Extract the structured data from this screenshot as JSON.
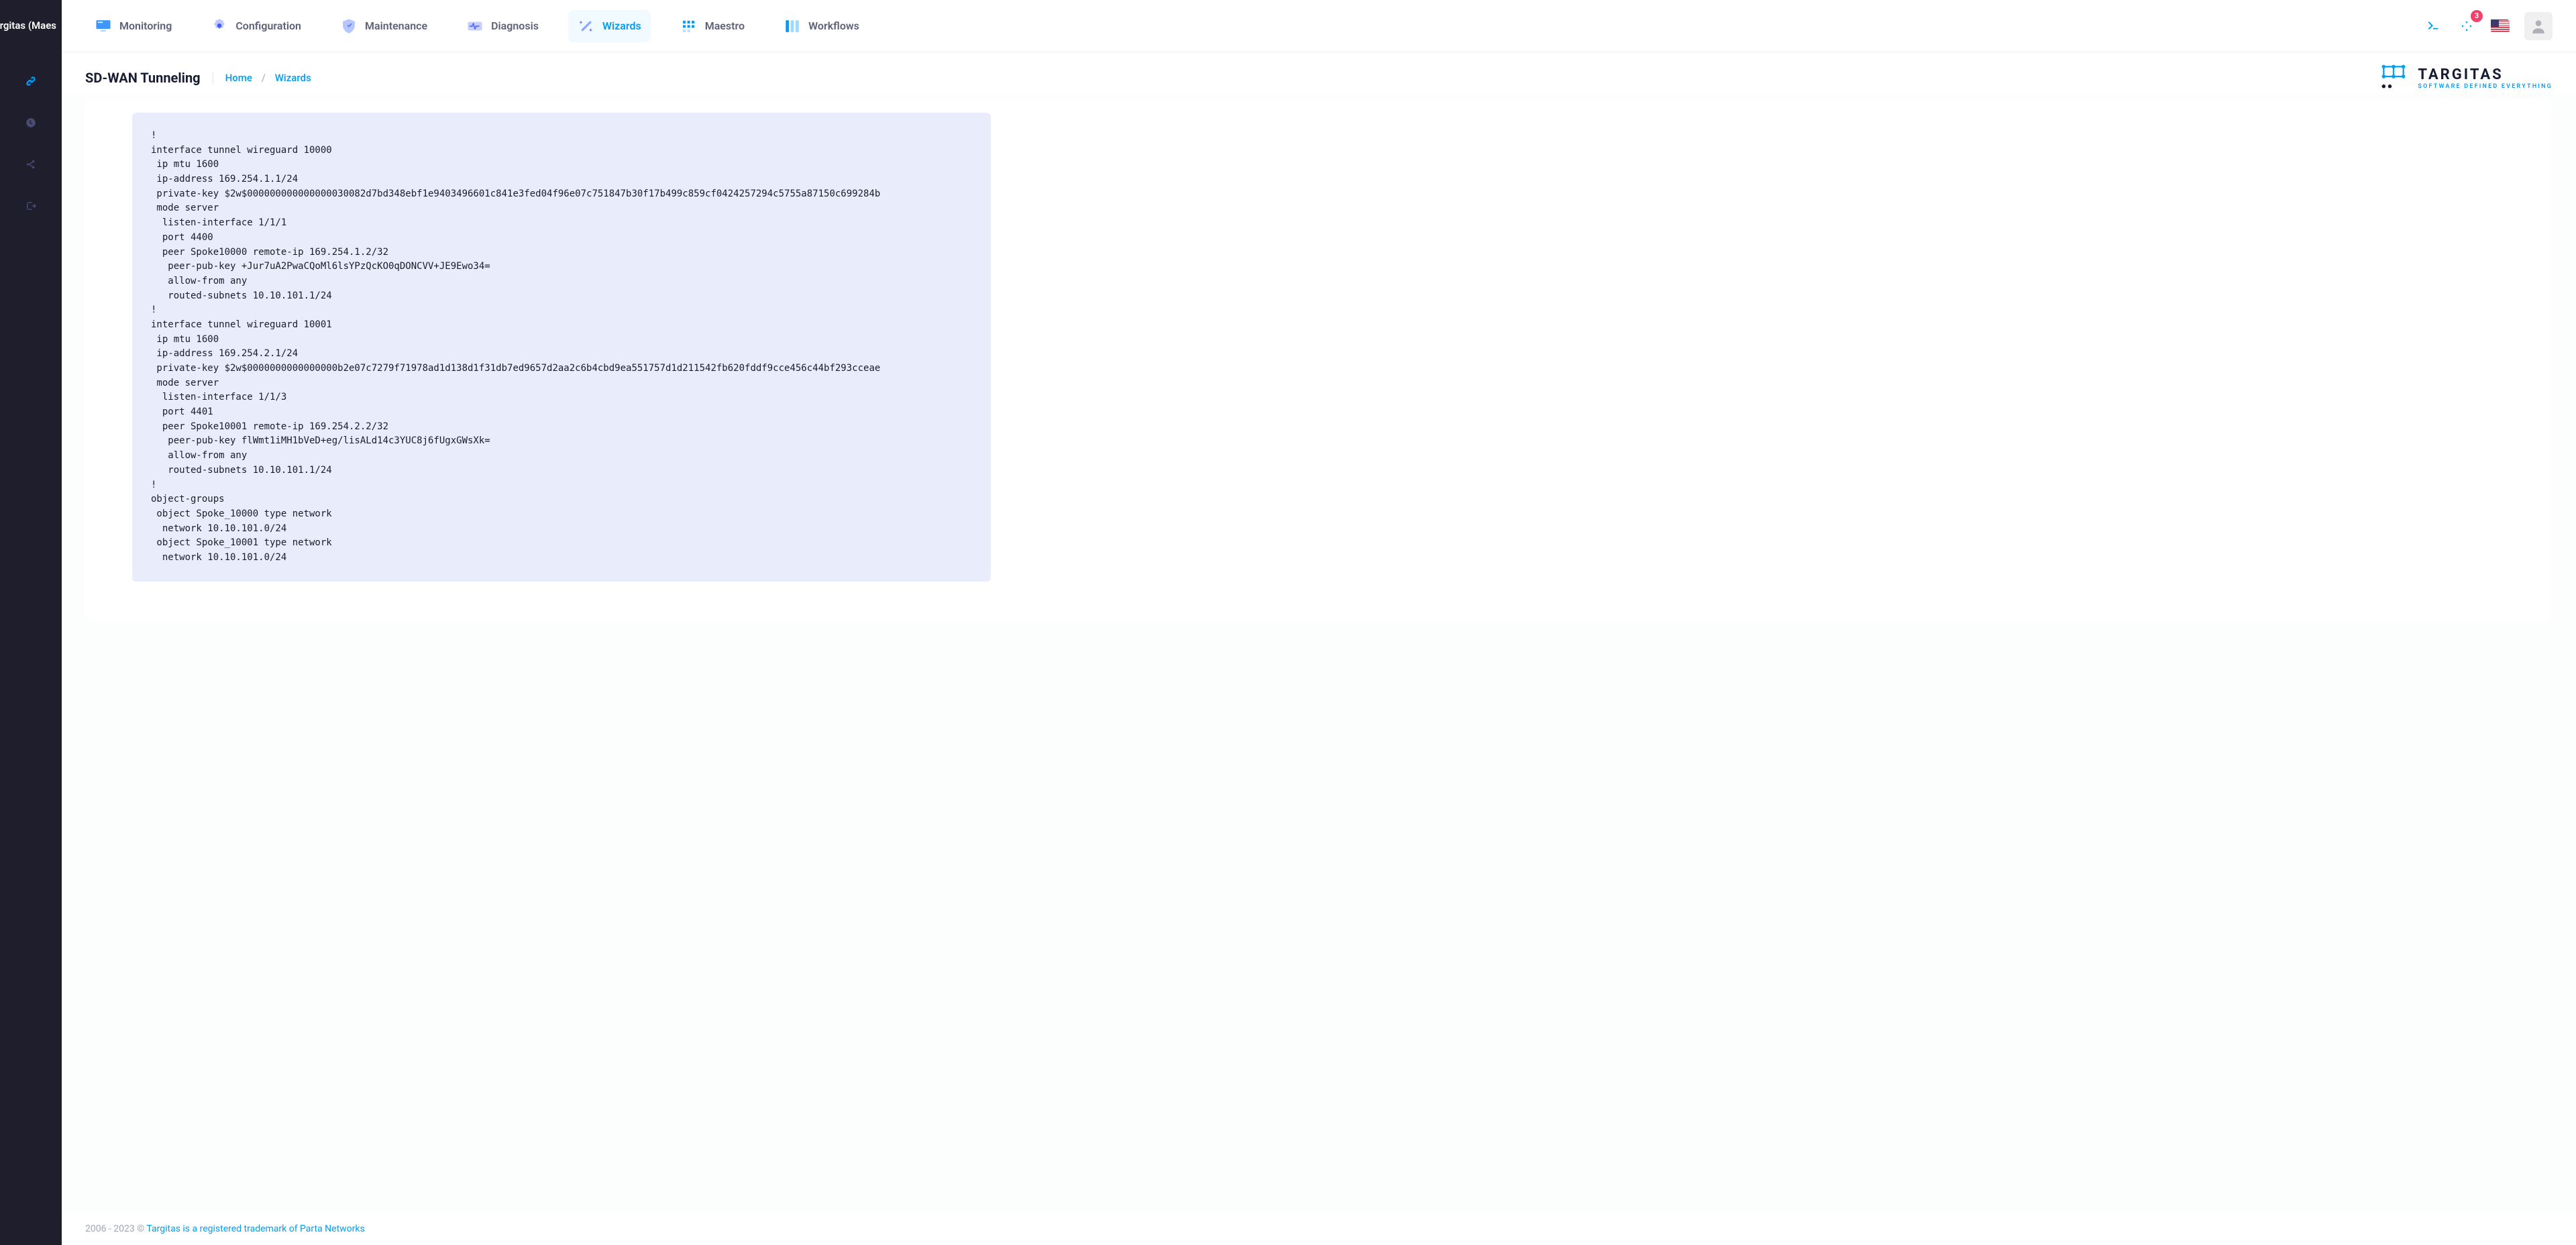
{
  "sidebar": {
    "brand_truncated": "rgitas (Maes"
  },
  "nav": {
    "items": [
      {
        "label": "Monitoring"
      },
      {
        "label": "Configuration"
      },
      {
        "label": "Maintenance"
      },
      {
        "label": "Diagnosis"
      },
      {
        "label": "Wizards"
      },
      {
        "label": "Maestro"
      },
      {
        "label": "Workflows"
      }
    ],
    "badge_count": "3"
  },
  "page": {
    "title": "SD-WAN Tunneling",
    "crumb_home": "Home",
    "crumb_sep": "/",
    "crumb_wizards": "Wizards"
  },
  "brand": {
    "name": "TARGITAS",
    "tagline": "SOFTWARE DEFINED EVERYTHING"
  },
  "config_output": "!\ninterface tunnel wireguard 10000\n ip mtu 1600\n ip-address 169.254.1.1/24\n private-key $2w$000000000000000030082d7bd348ebf1e9403496601c841e3fed04f96e07c751847b30f17b499c859cf0424257294c5755a87150c699284b\n mode server\n  listen-interface 1/1/1\n  port 4400\n  peer Spoke10000 remote-ip 169.254.1.2/32\n   peer-pub-key +Jur7uA2PwaCQoMl6lsYPzQcKO0qDONCVV+JE9Ewo34=\n   allow-from any\n   routed-subnets 10.10.101.1/24\n!\ninterface tunnel wireguard 10001\n ip mtu 1600\n ip-address 169.254.2.1/24\n private-key $2w$0000000000000000b2e07c7279f71978ad1d138d1f31db7ed9657d2aa2c6b4cbd9ea551757d1d211542fb620fddf9cce456c44bf293cceae\n mode server\n  listen-interface 1/1/3\n  port 4401\n  peer Spoke10001 remote-ip 169.254.2.2/32\n   peer-pub-key flWmt1iMH1bVeD+eg/lisALd14c3YUC8j6fUgxGWsXk=\n   allow-from any\n   routed-subnets 10.10.101.1/24\n!\nobject-groups\n object Spoke_10000 type network\n  network 10.10.101.0/24\n object Spoke_10001 type network\n  network 10.10.101.0/24",
  "footer": {
    "years": "2006 - 2023 ©",
    "text": "Targitas is a registered trademark of Parta Networks"
  }
}
